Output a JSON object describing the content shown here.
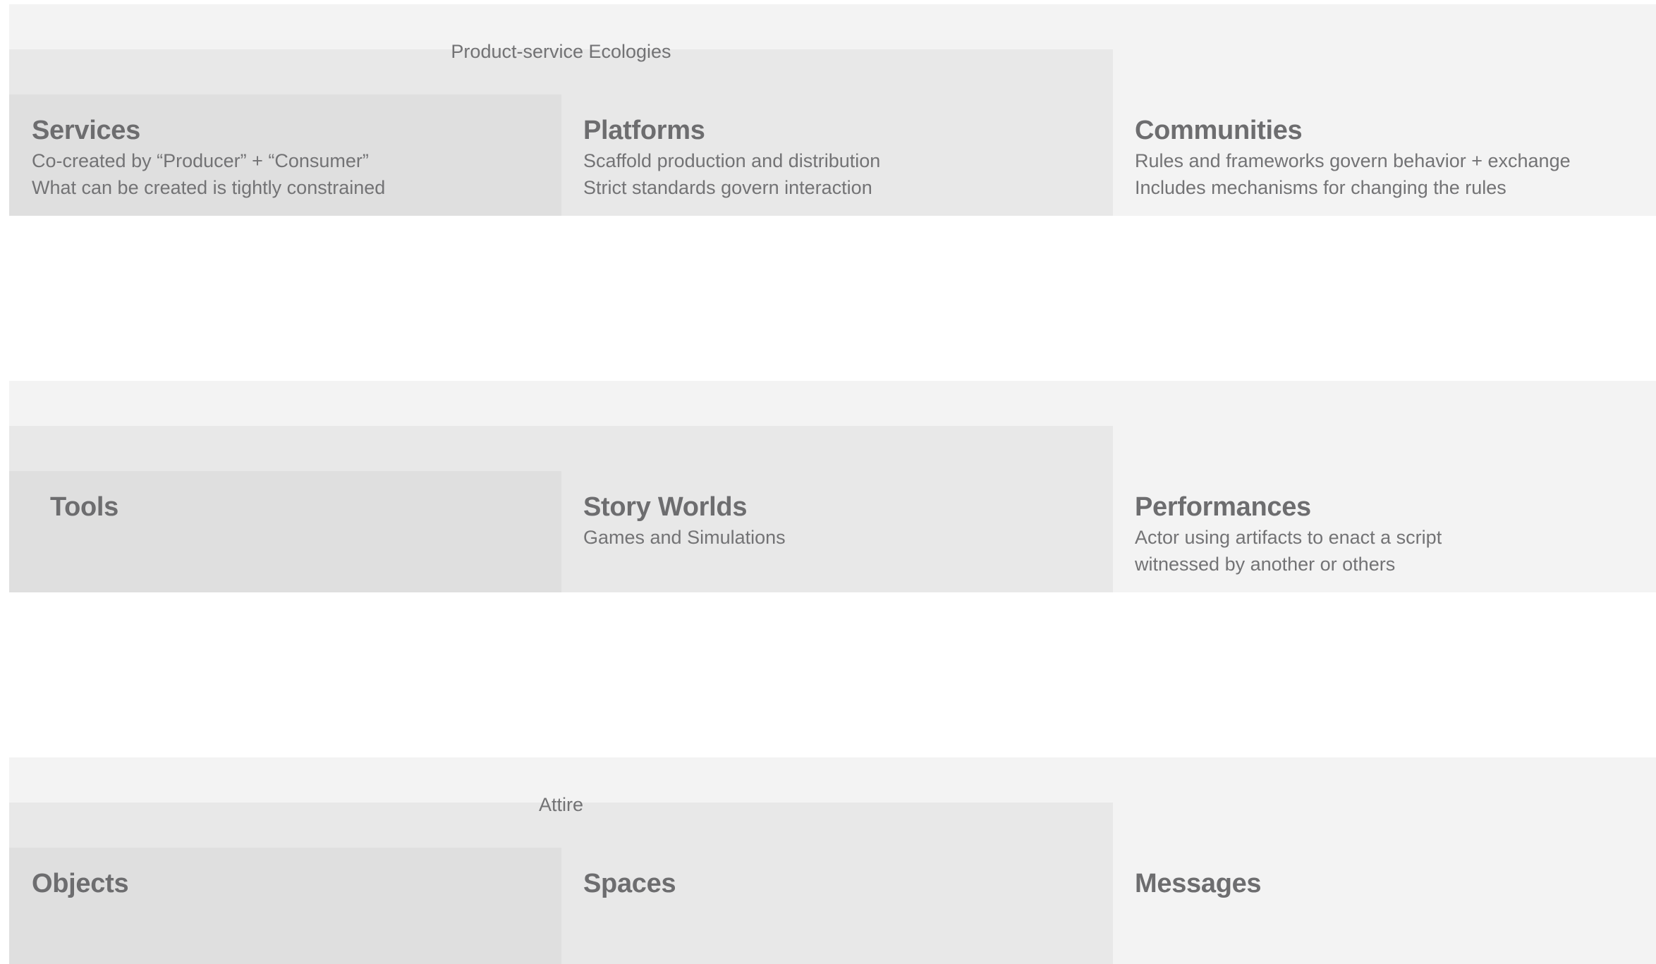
{
  "rows": [
    {
      "band_label": "Product-service Ecologies",
      "cells": [
        {
          "title": "Services",
          "lines": [
            "Co-created by “Producer” + “Consumer”",
            "What can be created is tightly constrained"
          ]
        },
        {
          "title": "Platforms",
          "lines": [
            "Scaffold production and distribution",
            "Strict standards govern interaction"
          ]
        },
        {
          "title": "Communities",
          "lines": [
            "Rules and frameworks govern behavior + exchange",
            "Includes mechanisms for changing the rules"
          ]
        }
      ]
    },
    {
      "band_label": "",
      "cells": [
        {
          "title": "Tools",
          "lines": []
        },
        {
          "title": "Story Worlds",
          "lines": [
            "Games and Simulations"
          ]
        },
        {
          "title": "Performances",
          "lines": [
            "Actor using artifacts to enact a script",
            "witnessed by another or others"
          ]
        }
      ]
    },
    {
      "band_label": "Attire",
      "cells": [
        {
          "title": "Objects",
          "lines": []
        },
        {
          "title": "Spaces",
          "lines": []
        },
        {
          "title": "Messages",
          "lines": []
        }
      ]
    }
  ],
  "colors": {
    "background": "#ffffff",
    "outer_band": "#f3f3f3",
    "middle_block": "#e8e8e8",
    "inner_block": "#dfdfdf",
    "text": "#6d6d6f"
  }
}
